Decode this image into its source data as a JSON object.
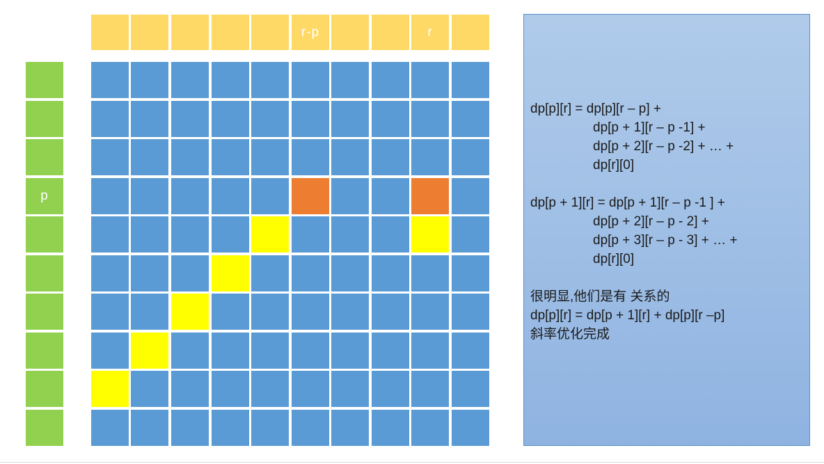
{
  "colors": {
    "header": "#ffd966",
    "row_label": "#92d050",
    "grid": "#5b9bd5",
    "highlight": "#ed7d31",
    "diagonal": "#ffff00"
  },
  "top_labels": [
    "",
    "",
    "",
    "",
    "",
    "r-p",
    "",
    "",
    "r",
    ""
  ],
  "left_labels": [
    "",
    "",
    "",
    "p",
    "",
    "",
    "",
    "",
    "",
    ""
  ],
  "grid": [
    [
      "b",
      "b",
      "b",
      "b",
      "b",
      "b",
      "b",
      "b",
      "b",
      "b"
    ],
    [
      "b",
      "b",
      "b",
      "b",
      "b",
      "b",
      "b",
      "b",
      "b",
      "b"
    ],
    [
      "b",
      "b",
      "b",
      "b",
      "b",
      "b",
      "b",
      "b",
      "b",
      "b"
    ],
    [
      "b",
      "b",
      "b",
      "b",
      "b",
      "o",
      "b",
      "b",
      "o",
      "b"
    ],
    [
      "b",
      "b",
      "b",
      "b",
      "y",
      "b",
      "b",
      "b",
      "y",
      "b"
    ],
    [
      "b",
      "b",
      "b",
      "y",
      "b",
      "b",
      "b",
      "b",
      "b",
      "b"
    ],
    [
      "b",
      "b",
      "y",
      "b",
      "b",
      "b",
      "b",
      "b",
      "b",
      "b"
    ],
    [
      "b",
      "y",
      "b",
      "b",
      "b",
      "b",
      "b",
      "b",
      "b",
      "b"
    ],
    [
      "y",
      "b",
      "b",
      "b",
      "b",
      "b",
      "b",
      "b",
      "b",
      "b"
    ],
    [
      "b",
      "b",
      "b",
      "b",
      "b",
      "b",
      "b",
      "b",
      "b",
      "b"
    ]
  ],
  "note": {
    "lines": [
      {
        "text": "dp[p][r] = dp[p][r – p] +",
        "indent": false
      },
      {
        "text": "dp[p + 1][r – p -1] +",
        "indent": true
      },
      {
        "text": "dp[p + 2][r – p -2] + … +",
        "indent": true
      },
      {
        "text": "dp[r][0]",
        "indent": true
      },
      {
        "text": "",
        "indent": false
      },
      {
        "text": "dp[p + 1][r] = dp[p + 1][r – p -1 ] +",
        "indent": false
      },
      {
        "text": "dp[p + 2][r – p - 2] +",
        "indent": true
      },
      {
        "text": "dp[p + 3][r – p - 3] + … +",
        "indent": true
      },
      {
        "text": "dp[r][0]",
        "indent": true
      },
      {
        "text": "",
        "indent": false
      },
      {
        "text": "很明显,他们是有 关系的",
        "indent": false
      },
      {
        "text": "dp[p][r] = dp[p + 1][r] + dp[p][r –p]",
        "indent": false
      },
      {
        "text": "斜率优化完成",
        "indent": false
      }
    ]
  }
}
